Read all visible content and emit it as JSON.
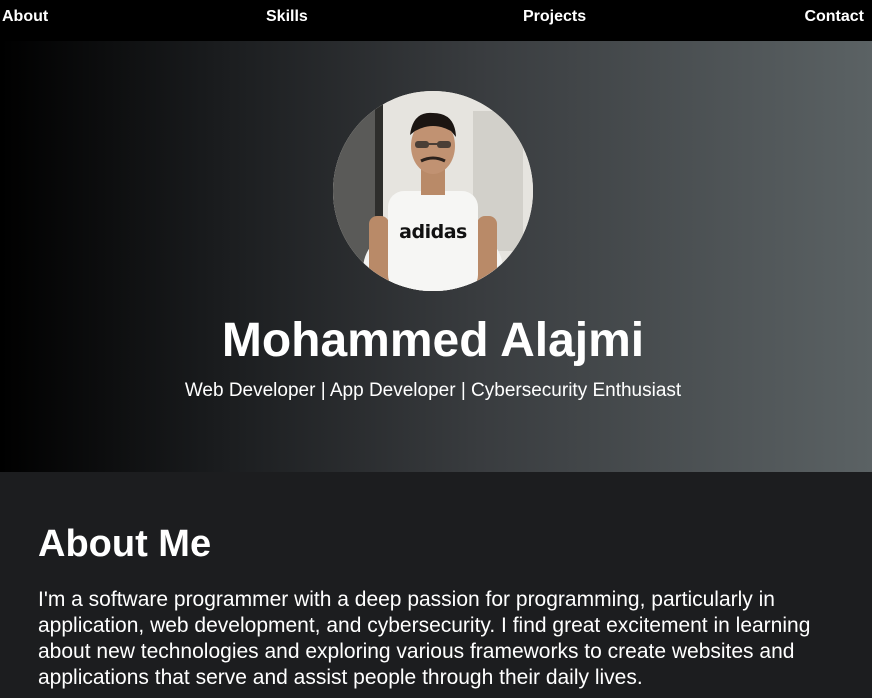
{
  "nav": {
    "items": [
      {
        "label": "About"
      },
      {
        "label": "Skills"
      },
      {
        "label": "Projects"
      },
      {
        "label": "Contact"
      }
    ]
  },
  "hero": {
    "name": "Mohammed Alajmi",
    "tagline": "Web Developer | App Developer | Cybersecurity Enthusiast",
    "shirt_text": "adidas"
  },
  "about": {
    "title": "About Me",
    "text": "I'm a software programmer with a deep passion for programming, particularly in application, web development, and cybersecurity. I find great excitement in learning about new technologies and exploring various frameworks to create websites and applications that serve and assist people through their daily lives."
  },
  "colors": {
    "nav_background": "#000000",
    "hero_gradient_start": "#000000",
    "hero_gradient_end": "#5b6264",
    "about_background": "#1c1d1f",
    "text": "#ffffff"
  }
}
